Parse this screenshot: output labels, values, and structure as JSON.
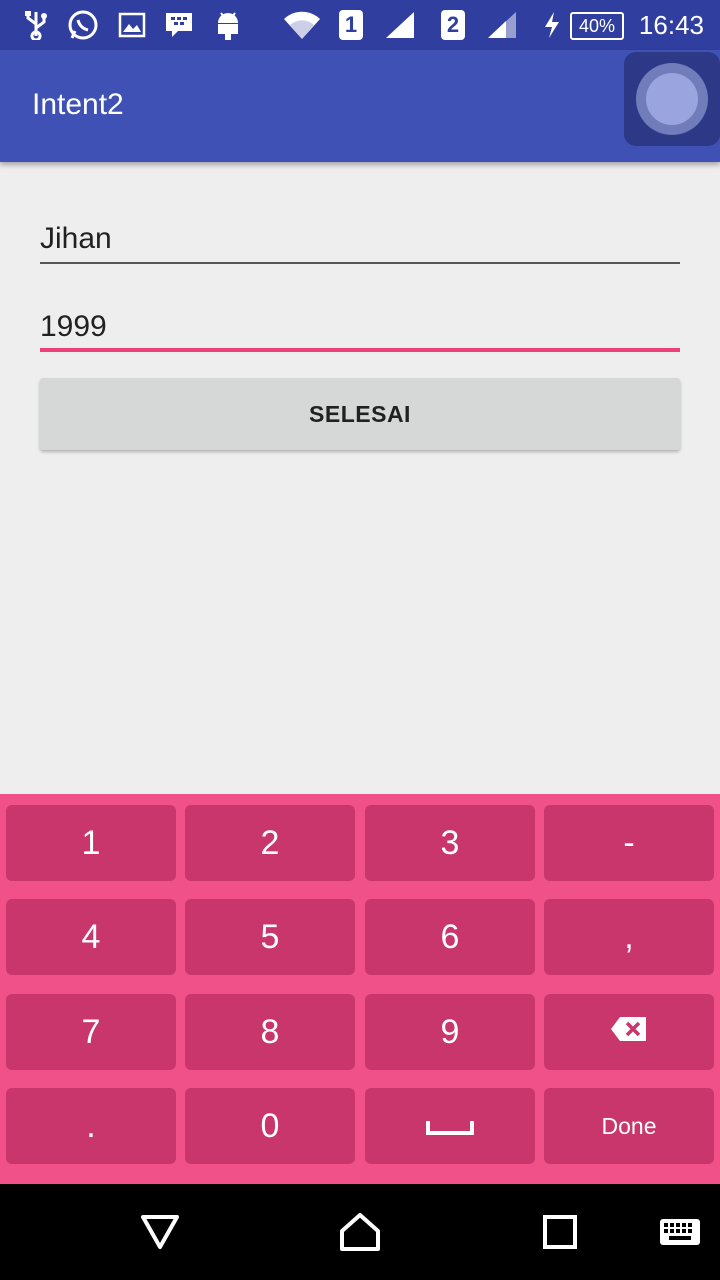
{
  "status_bar": {
    "icons": [
      "usb-icon",
      "whatsapp-icon",
      "gallery-icon",
      "bbm-icon",
      "android-icon",
      "wifi-icon",
      "sim1-signal-icon",
      "sim2-signal-icon",
      "charging-icon"
    ],
    "sim1_label": "1",
    "sim2_label": "2",
    "battery": "40%",
    "time": "16:43"
  },
  "app_bar": {
    "title": "Intent2"
  },
  "form": {
    "name_value": "Jihan",
    "year_value": "1999",
    "submit_label": "SELESAI"
  },
  "keyboard": {
    "keys": [
      "1",
      "2",
      "3",
      "-",
      "4",
      "5",
      "6",
      ",",
      "7",
      "8",
      "9",
      ".",
      "0"
    ],
    "backspace_icon": "backspace-icon",
    "space_icon": "space-icon",
    "done_label": "Done"
  },
  "nav_bar": {
    "icons": [
      "back-icon",
      "home-icon",
      "recents-icon",
      "keyboard-switch-icon"
    ]
  },
  "colors": {
    "status_bar": "#303f9f",
    "app_bar": "#3f51b5",
    "accent": "#ec407a",
    "keyboard_bg": "#f05189",
    "key_bg": "#c8366b"
  }
}
